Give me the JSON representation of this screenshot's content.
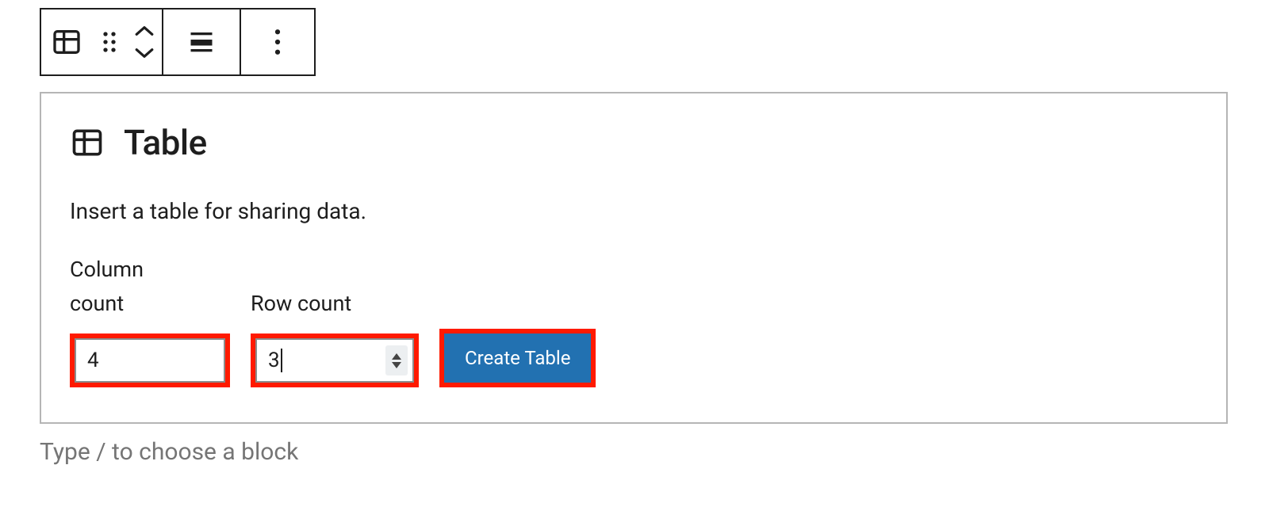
{
  "toolbar": {
    "icons": {
      "block_type": "table-icon",
      "drag": "drag-handle-icon",
      "move_up": "chevron-up-icon",
      "move_down": "chevron-down-icon",
      "align": "align-icon",
      "more": "more-options-icon"
    }
  },
  "block": {
    "title": "Table",
    "description": "Insert a table for sharing data.",
    "column_count_label": "Column count",
    "row_count_label": "Row count",
    "column_count_value": "4",
    "row_count_value": "3",
    "create_button_label": "Create Table"
  },
  "editor": {
    "add_block_hint": "Type / to choose a block"
  },
  "colors": {
    "highlight": "#ff1a00",
    "primary_button": "#2271b1"
  }
}
